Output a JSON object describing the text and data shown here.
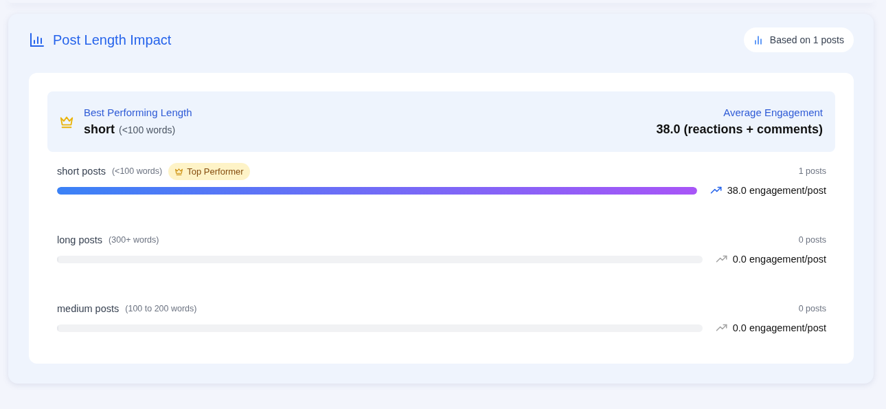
{
  "title": "Post Length Impact",
  "based_on": "Based on 1 posts",
  "best": {
    "label": "Best Performing Length",
    "value": "short",
    "range": "(<100 words)",
    "avg_label": "Average Engagement",
    "avg_value": "38.0 (reactions + comments)"
  },
  "rows": [
    {
      "name": "short posts",
      "range": "(<100 words)",
      "top": true,
      "badge": "Top Performer",
      "count": "1 posts",
      "level": 1,
      "engagement": "38.0 engagement/post"
    },
    {
      "name": "long posts",
      "range": "(300+ words)",
      "top": false,
      "count": "0 posts",
      "level": 0,
      "engagement": "0.0 engagement/post"
    },
    {
      "name": "medium posts",
      "range": "(100 to 200 words)",
      "top": false,
      "count": "0 posts",
      "level": 0,
      "engagement": "0.0 engagement/post"
    }
  ]
}
